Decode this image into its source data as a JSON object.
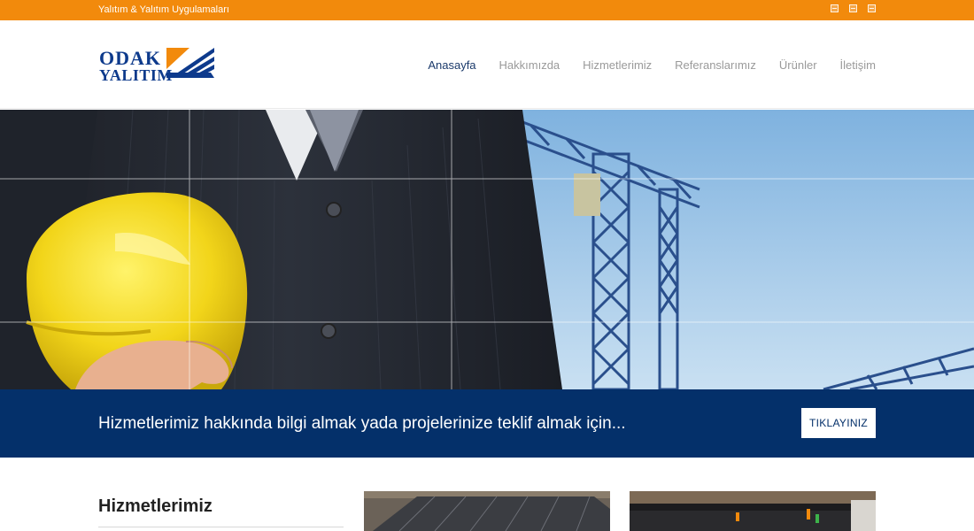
{
  "topbar": {
    "tagline": "Yalıtım & Yalıtım Uygulamaları",
    "background": "#f28a0c",
    "social_icons": [
      "social-icon-1",
      "social-icon-2",
      "social-icon-3"
    ]
  },
  "logo": {
    "line1": "ODAK",
    "line2": "YALITIM",
    "brand_blue": "#0d3a8c",
    "brand_orange": "#f28a0c"
  },
  "nav": {
    "items": [
      {
        "label": "Anasayfa",
        "active": true
      },
      {
        "label": "Hakkımızda",
        "active": false
      },
      {
        "label": "Hizmetlerimiz",
        "active": false
      },
      {
        "label": "Referanslarımız",
        "active": false
      },
      {
        "label": "Ürünler",
        "active": false
      },
      {
        "label": "İletişim",
        "active": false
      }
    ]
  },
  "cta": {
    "text": "Hizmetlerimiz hakkında bilgi almak yada projelerinize teklif almak için...",
    "button_label": "TIKLAYINIZ",
    "background": "#04306a"
  },
  "services": {
    "title": "Hizmetlerimiz"
  }
}
